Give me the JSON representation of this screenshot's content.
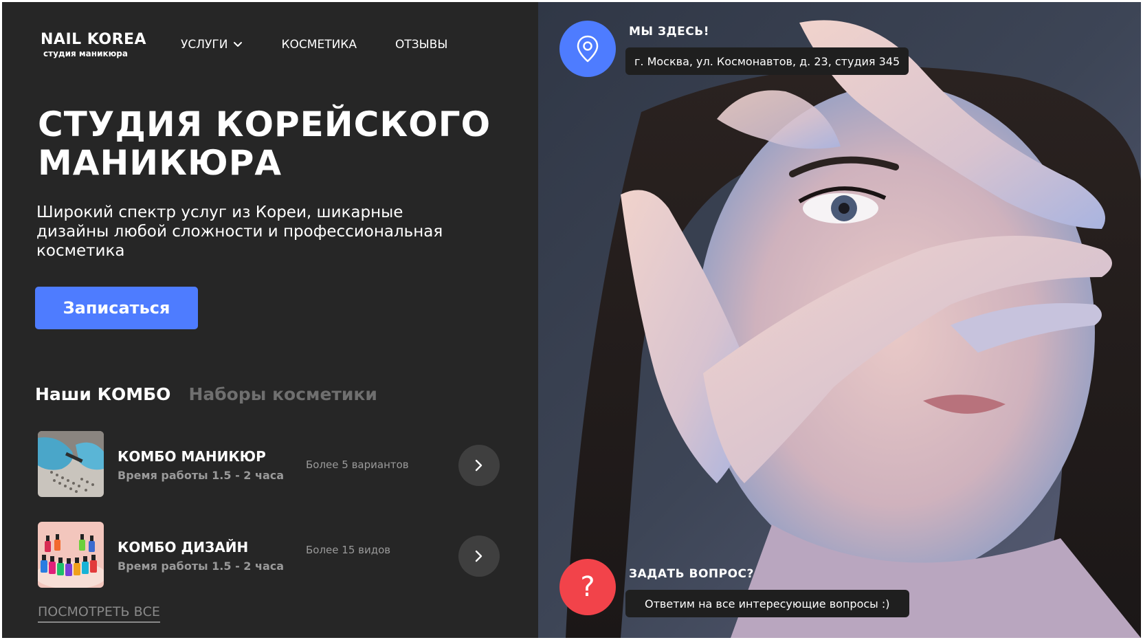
{
  "logo": {
    "title": "NAIL KOREA",
    "subtitle": "студия маникюра"
  },
  "nav": {
    "items": [
      {
        "label": "УСЛУГИ",
        "has_dropdown": true
      },
      {
        "label": "КОСМЕТИКА"
      },
      {
        "label": "ОТЗЫВЫ"
      }
    ]
  },
  "hero": {
    "title_line1": "СТУДИЯ КОРЕЙСКОГО",
    "title_line2": "МАНИКЮРА",
    "subtitle": "Широкий спектр услуг из Кореи, шикарные дизайны любой сложности и профессиональная косметика",
    "cta_label": "Записаться"
  },
  "tabs": [
    {
      "label": "Наши КОМБО",
      "active": true
    },
    {
      "label": "Наборы косметики",
      "active": false
    }
  ],
  "combos": [
    {
      "name": "КОМБО МАНИКЮР",
      "time": "Время работы 1.5 - 2 часа",
      "count": "Более 5 вариантов",
      "thumb_icon": "manicure-photo"
    },
    {
      "name": "КОМБО ДИЗАЙН",
      "time": "Время работы 1.5 - 2 часа",
      "count": "Более 15 видов",
      "thumb_icon": "nail-polish-photo"
    }
  ],
  "see_all_label": "ПОСМОТРЕТЬ ВСЕ",
  "location": {
    "label": "МЫ ЗДЕСЬ!",
    "address": "г. Москва, ул. Космонавтов, д. 23, студия 345",
    "icon": "location-pin-icon"
  },
  "question": {
    "label": "ЗАДАТЬ ВОПРОС?",
    "text": "Ответим на все интересующие вопросы :)",
    "mark": "?",
    "icon": "question-icon"
  },
  "colors": {
    "background_dark": "#262626",
    "accent_blue": "#4e7cff",
    "accent_red": "#f2434a",
    "muted_text": "#9a9a9a"
  }
}
